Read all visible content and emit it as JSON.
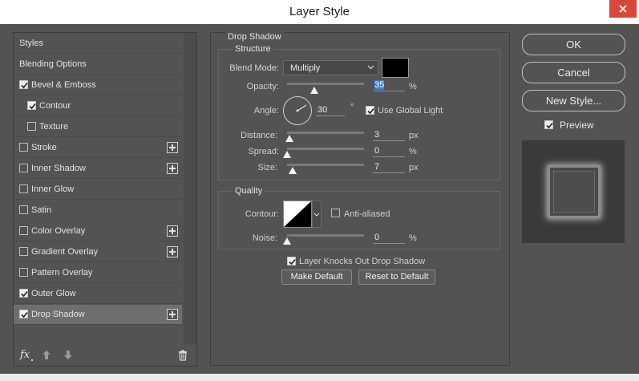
{
  "window": {
    "title": "Layer Style"
  },
  "styles_list": {
    "items": [
      {
        "label": "Styles",
        "checkbox": false,
        "checked": false,
        "plus": false,
        "selected": false
      },
      {
        "label": "Blending Options",
        "checkbox": false,
        "checked": false,
        "plus": false,
        "selected": false
      },
      {
        "label": "Bevel & Emboss",
        "checkbox": true,
        "checked": true,
        "plus": false,
        "selected": false
      },
      {
        "label": "Contour",
        "checkbox": true,
        "checked": true,
        "plus": false,
        "selected": false,
        "indent": true
      },
      {
        "label": "Texture",
        "checkbox": true,
        "checked": false,
        "plus": false,
        "selected": false,
        "indent": true
      },
      {
        "label": "Stroke",
        "checkbox": true,
        "checked": false,
        "plus": true,
        "selected": false
      },
      {
        "label": "Inner Shadow",
        "checkbox": true,
        "checked": false,
        "plus": true,
        "selected": false
      },
      {
        "label": "Inner Glow",
        "checkbox": true,
        "checked": false,
        "plus": false,
        "selected": false
      },
      {
        "label": "Satin",
        "checkbox": true,
        "checked": false,
        "plus": false,
        "selected": false
      },
      {
        "label": "Color Overlay",
        "checkbox": true,
        "checked": false,
        "plus": true,
        "selected": false
      },
      {
        "label": "Gradient Overlay",
        "checkbox": true,
        "checked": false,
        "plus": true,
        "selected": false
      },
      {
        "label": "Pattern Overlay",
        "checkbox": true,
        "checked": false,
        "plus": false,
        "selected": false
      },
      {
        "label": "Outer Glow",
        "checkbox": true,
        "checked": true,
        "plus": false,
        "selected": false
      },
      {
        "label": "Drop Shadow",
        "checkbox": true,
        "checked": true,
        "plus": true,
        "selected": true
      }
    ],
    "footer": {
      "fx_label": "fx"
    }
  },
  "drop_shadow": {
    "section_title": "Drop Shadow",
    "structure": {
      "title": "Structure",
      "blend_mode_label": "Blend Mode:",
      "blend_mode_value": "Multiply",
      "shadow_color": "#000000",
      "opacity_label": "Opacity:",
      "opacity_value": "35",
      "opacity_unit": "%",
      "angle_label": "Angle:",
      "angle_value": "30",
      "angle_unit": "°",
      "use_global_light_label": "Use Global Light",
      "use_global_light_checked": true,
      "distance_label": "Distance:",
      "distance_value": "3",
      "distance_unit": "px",
      "spread_label": "Spread:",
      "spread_value": "0",
      "spread_unit": "%",
      "size_label": "Size:",
      "size_value": "7",
      "size_unit": "px"
    },
    "quality": {
      "title": "Quality",
      "contour_label": "Contour:",
      "anti_aliased_label": "Anti-aliased",
      "anti_aliased_checked": false,
      "noise_label": "Noise:",
      "noise_value": "0",
      "noise_unit": "%"
    },
    "layer_knocks_out_label": "Layer Knocks Out Drop Shadow",
    "layer_knocks_out_checked": true,
    "make_default_label": "Make Default",
    "reset_to_default_label": "Reset to Default"
  },
  "actions": {
    "ok_label": "OK",
    "cancel_label": "Cancel",
    "new_style_label": "New Style...",
    "preview_label": "Preview",
    "preview_checked": true
  },
  "colors": {
    "panel_bg": "#535353",
    "selected_row": "#6e6e6e",
    "highlight": "#3b7bd6",
    "close_button": "#d9473a"
  }
}
